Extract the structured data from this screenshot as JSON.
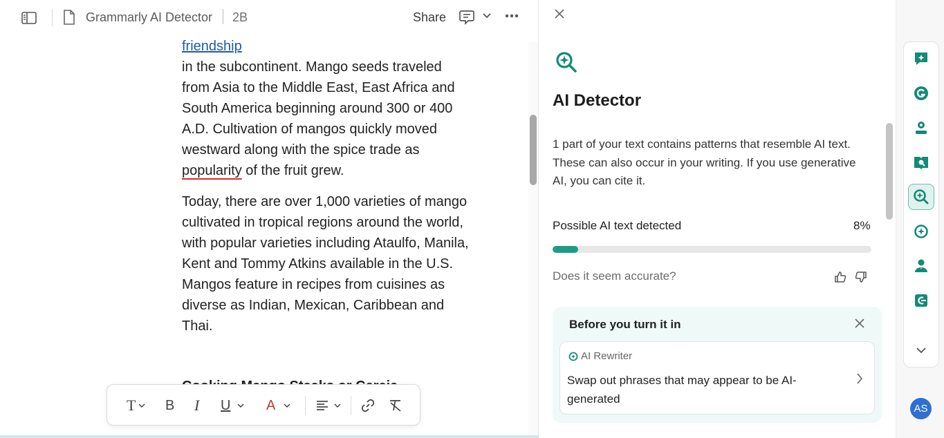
{
  "header": {
    "doc_title": "Grammarly AI Detector",
    "doc_size": "2B",
    "share_label": "Share"
  },
  "document": {
    "link_text": "friendship",
    "para1_lines": [
      "in the subcontinent. Mango seeds traveled",
      "from Asia to the Middle East, East Africa and",
      "South America beginning around 300 or 400",
      "A.D. Cultivation of mangos quickly moved",
      "westward along with the spice trade as"
    ],
    "para1_flagged": "popularity",
    "para1_tail": " of the fruit grew.",
    "para2_lines": [
      "Today, there are over 1,000 varieties of mango",
      "cultivated in tropical regions around the world,",
      "with popular varieties including Ataulfo, Manila,",
      "Kent and Tommy Atkins available in the U.S.",
      "Mangos feature in recipes from cuisines as",
      "diverse as Indian, Mexican, Caribbean and",
      "Thai."
    ],
    "heading_partial": "Cooking Mango Steaks or Cereja"
  },
  "format_toolbar": {
    "text_style": "T",
    "bold": "B",
    "italic": "I",
    "underline": "U",
    "font_color": "A"
  },
  "panel": {
    "title": "AI Detector",
    "description": "1 part of your text contains patterns that resemble AI text. These can also occur in your writing. If you use generative AI, you can cite it.",
    "detected_label": "Possible AI text detected",
    "detected_percent_text": "8%",
    "detected_fraction": 0.08,
    "accuracy_question": "Does it seem accurate?",
    "tip": {
      "title": "Before you turn it in",
      "rewriter_label": "AI Rewriter",
      "rewriter_text": "Swap out phrases that may appear to be AI-generated"
    }
  },
  "rail": {
    "items": [
      "sparkle-chat-icon",
      "grammarly-g-icon",
      "person-pin-icon",
      "book-check-icon",
      "ai-detector-icon",
      "rewriter-icon",
      "expert-icon",
      "citation-icon"
    ],
    "active_item": "ai-detector-icon"
  },
  "user": {
    "initials": "AS"
  },
  "colors": {
    "accent": "#1e9b86",
    "flag_underline": "#d62b2b",
    "link": "#1e5aa8",
    "avatar": "#2f6fd0"
  }
}
